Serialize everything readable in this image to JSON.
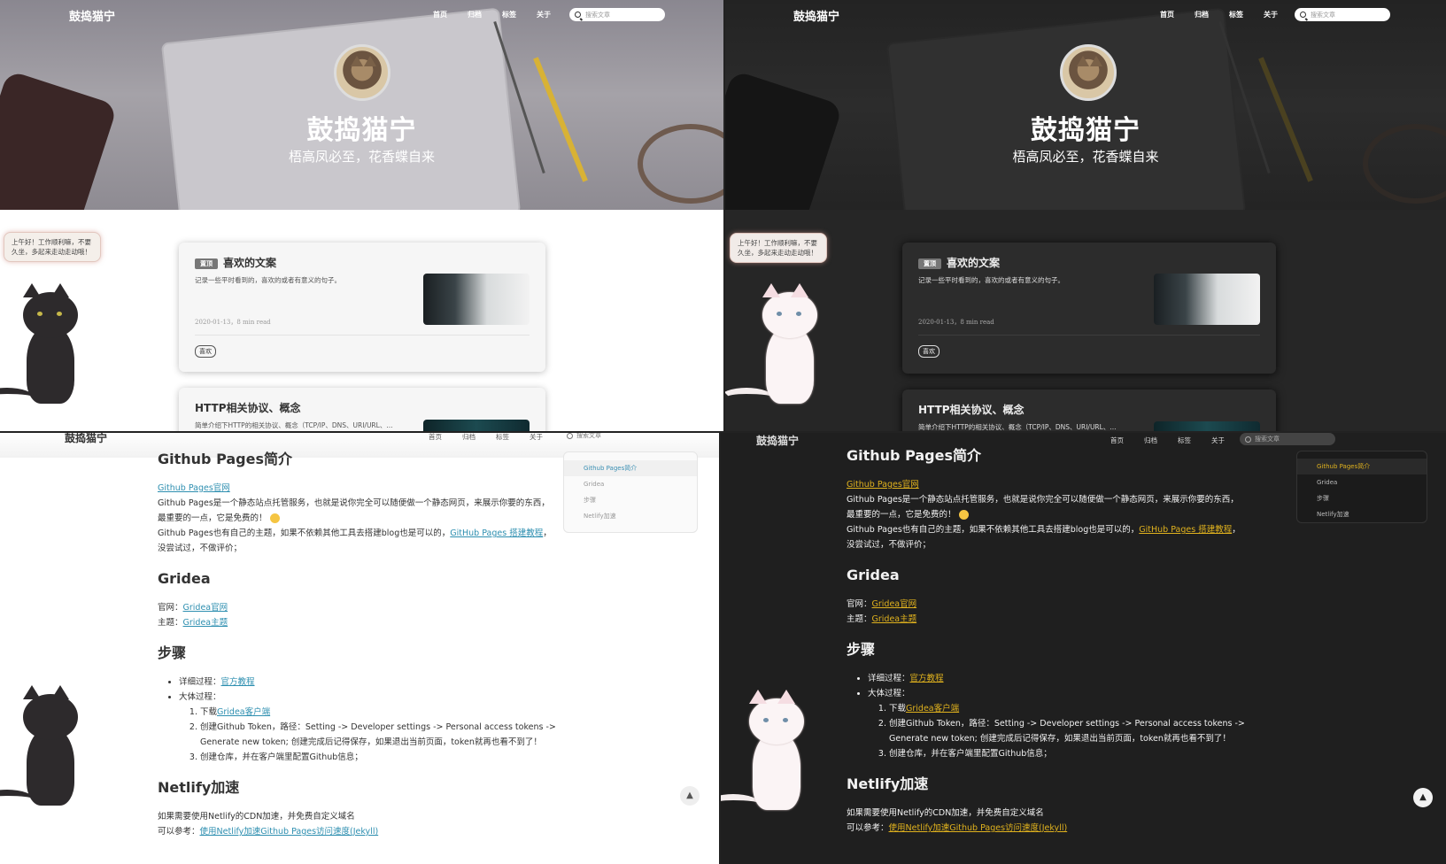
{
  "site": {
    "brand": "鼓捣猫宁",
    "title": "鼓捣猫宁",
    "subtitle": "梧高凤必至，花香蝶自来",
    "nav": [
      "首页",
      "归档",
      "标签",
      "关于"
    ],
    "search_placeholder": "搜索文章"
  },
  "greeting": "上午好！工作顺利嘛，不要久坐，多起来走动走动哦！",
  "posts": [
    {
      "pin_label": "置顶",
      "title": "喜欢的文案",
      "desc": "记录一些平时看到的，喜欢的或者有意义的句子。",
      "meta": "2020-01-13，8 min read",
      "tag": "喜欢"
    },
    {
      "title": "HTTP相关协议、概念",
      "desc": "简单介绍下HTTP的相关协议、概念（TCP/IP、DNS、URI/URL、..."
    }
  ],
  "article": {
    "sec1_title": "Github Pages简介",
    "sec1_link": "Github Pages官网",
    "sec1_p1": "Github Pages是一个静态站点托管服务，也就是说你完全可以随便做一个静态网页，来展示你要的东西，最重要的一点，它是免费的！",
    "sec1_p2_a": "Github Pages也有自己的主题，如果不依赖其他工具去搭建blog也是可以的，",
    "sec1_p2_link": "GitHub Pages 搭建教程",
    "sec1_p2_b": "，没尝试过，不做评价；",
    "sec2_title": "Gridea",
    "sec2_site_label": "官网：",
    "sec2_site_link": "Gridea官网",
    "sec2_theme_label": "主题：",
    "sec2_theme_link": "Gridea主题",
    "sec3_title": "步骤",
    "sec3_li1_label": "详细过程：",
    "sec3_li1_link": "官方教程",
    "sec3_li2_label": "大体过程：",
    "sec3_step1_a": "下载",
    "sec3_step1_link": "Gridea客户端",
    "sec3_step2": "创建Github Token，路径：Setting -> Developer settings -> Personal access tokens -> Generate new token; 创建完成后记得保存，如果退出当前页面，token就再也看不到了！",
    "sec3_step3": "创建仓库，并在客户端里配置Github信息；",
    "sec4_title": "Netlify加速",
    "sec4_p1": "如果需要使用Netlify的CDN加速，并免费自定义域名",
    "sec4_p2_label": "可以参考：",
    "sec4_p2_link": "使用Netlify加速Github Pages访问速度(Jekyll)"
  },
  "toc": [
    "Github Pages简介",
    "Gridea",
    "步骤",
    "Netlify加速"
  ],
  "colors": {
    "link_light": "#2e8fb0",
    "link_dark": "#e0b21e",
    "dark_bg": "#262626"
  }
}
